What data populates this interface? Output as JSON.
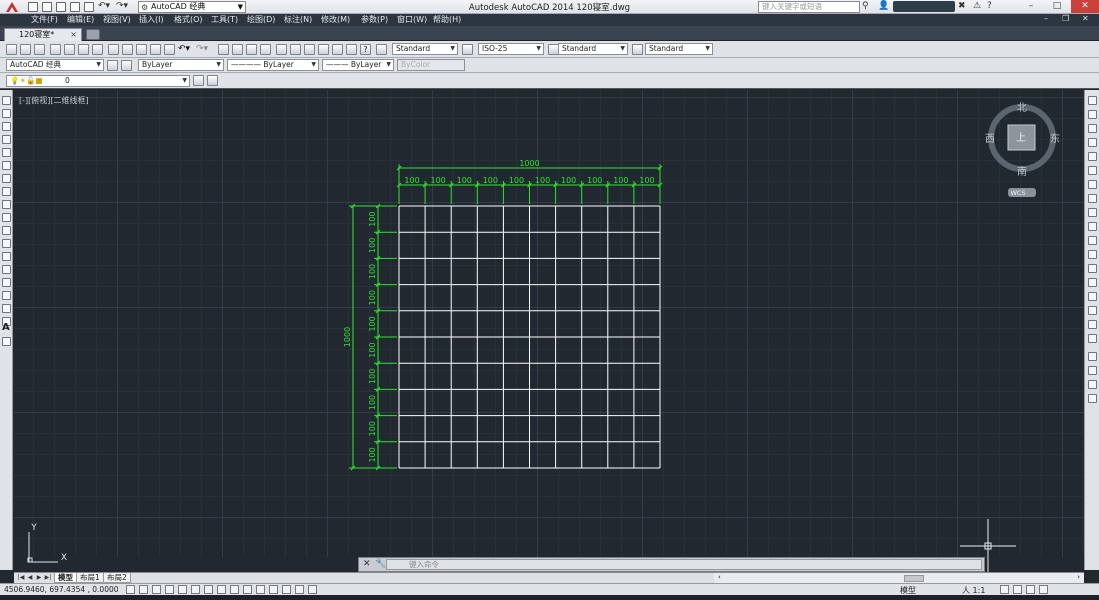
{
  "app": {
    "title": "Autodesk AutoCAD 2014    120寝室.dwg",
    "workspace": "AutoCAD 经典",
    "search_placeholder": "键入关键字或短语"
  },
  "menu": [
    "文件(F)",
    "编辑(E)",
    "视图(V)",
    "插入(I)",
    "格式(O)",
    "工具(T)",
    "绘图(D)",
    "标注(N)",
    "修改(M)",
    "参数(P)",
    "窗口(W)",
    "帮助(H)"
  ],
  "tabs": {
    "document": "120寝室*"
  },
  "toolbar": {
    "text_style": "Standard",
    "dim_style": "ISO-25",
    "table_style": "Standard",
    "mleader_style": "Standard",
    "workspace2": "AutoCAD 经典",
    "color": "ByLayer",
    "linetype": "ByLayer",
    "lineweight": "ByLayer",
    "plotstyle": "ByColor",
    "layer": "0"
  },
  "viewport": {
    "label": "[-][俯视][二维线框]"
  },
  "viewcube": {
    "north": "北",
    "south": "南",
    "east": "东",
    "west": "西",
    "top": "上",
    "wcs": "WCS"
  },
  "drawing": {
    "total_width_label": "1000",
    "total_height_label": "1000",
    "cell_label": "100",
    "columns": 10,
    "rows": 10,
    "line_color": "#ffffff",
    "dim_color": "#2ee62e"
  },
  "ucs": {
    "y": "Y",
    "x": "X"
  },
  "command": {
    "placeholder": "键入命令"
  },
  "layout_tabs": [
    "模型",
    "布局1",
    "布局2"
  ],
  "status": {
    "coords": "4506.9460, 697.4354 , 0.0000",
    "model": "模型",
    "scale": "人 1:1"
  },
  "colors": {
    "canvas_bg": "#212830",
    "menu_bg": "#2d3540",
    "close_button": "#c9413a"
  }
}
